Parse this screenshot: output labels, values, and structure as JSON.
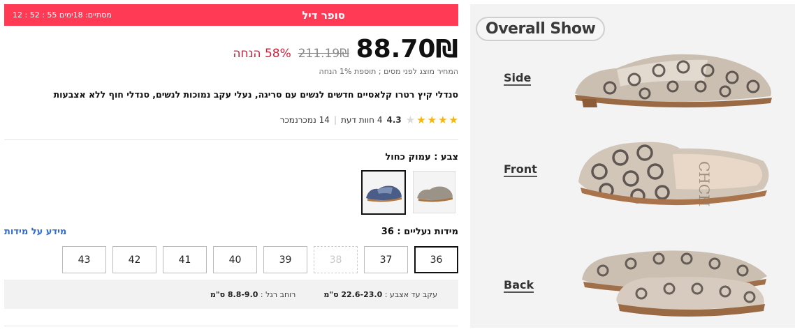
{
  "deal": {
    "title": "סופר דיל",
    "timer_label": "מסתיים: 18ימים",
    "timer_value": "12 : 52 : 55"
  },
  "price": {
    "current": "88.70₪",
    "old": "211.19₪",
    "discount": "58% הנחה",
    "tax_note": "המחיר מוצג לפני מסים ; תוספת 1% הנחה"
  },
  "product": {
    "title": "סנדלי קיץ רטרו קלאסיים חדשים לנשים עם סריגה, נעלי עקב נמוכות לנשים, סנדלי חוף ללא אצבעות"
  },
  "rating": {
    "value": "4.3",
    "reviews": "4 חוות דעת",
    "sold": "14 נמכרנמכר"
  },
  "color": {
    "label": "צבע : עמוק כחול",
    "swatches": [
      "deep-blue",
      "beige-pattern"
    ]
  },
  "size": {
    "label": "מידות נעליים : 36",
    "guide": "מידע על מידות",
    "options": [
      "36",
      "37",
      "38",
      "39",
      "40",
      "41",
      "42",
      "43"
    ]
  },
  "fit": {
    "heel_label": "עקב עד אצבע :",
    "heel_value": "22.6-23.0 ס\"מ",
    "width_label": "רוחב רגל :",
    "width_value": "8.8-9.0 ס\"מ"
  },
  "gallery": {
    "badge": "Overall Show",
    "views": [
      "Side",
      "Front",
      "Back"
    ]
  },
  "colors": {
    "accent": "#ff3a55",
    "discount": "#d21f3c",
    "link": "#2e6bd2",
    "star": "#f6b60a"
  }
}
